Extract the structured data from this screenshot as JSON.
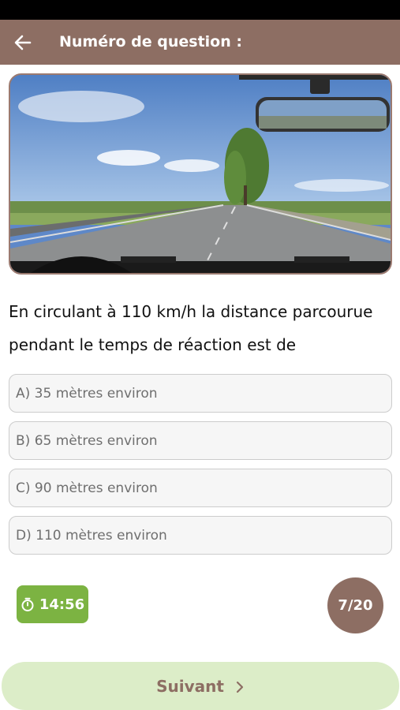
{
  "header": {
    "title": "Numéro de question :"
  },
  "question": {
    "text": "En circulant à 110 km/h la distance parcourue pendant le temps de réaction est de"
  },
  "options": [
    {
      "label": "A) 35 mètres environ"
    },
    {
      "label": "B) 65 mètres environ"
    },
    {
      "label": "C) 90 mètres environ"
    },
    {
      "label": "D) 110 mètres environ"
    }
  ],
  "timer": {
    "value": "14:56",
    "icon": "stopwatch-icon"
  },
  "progress": {
    "value": "7/20"
  },
  "next": {
    "label": "Suivant",
    "icon": "chevron-right-icon"
  },
  "colors": {
    "header": "#8d6e63",
    "timer": "#7cb342",
    "next_bg": "#dcedc8",
    "counter": "#8d6e63"
  }
}
